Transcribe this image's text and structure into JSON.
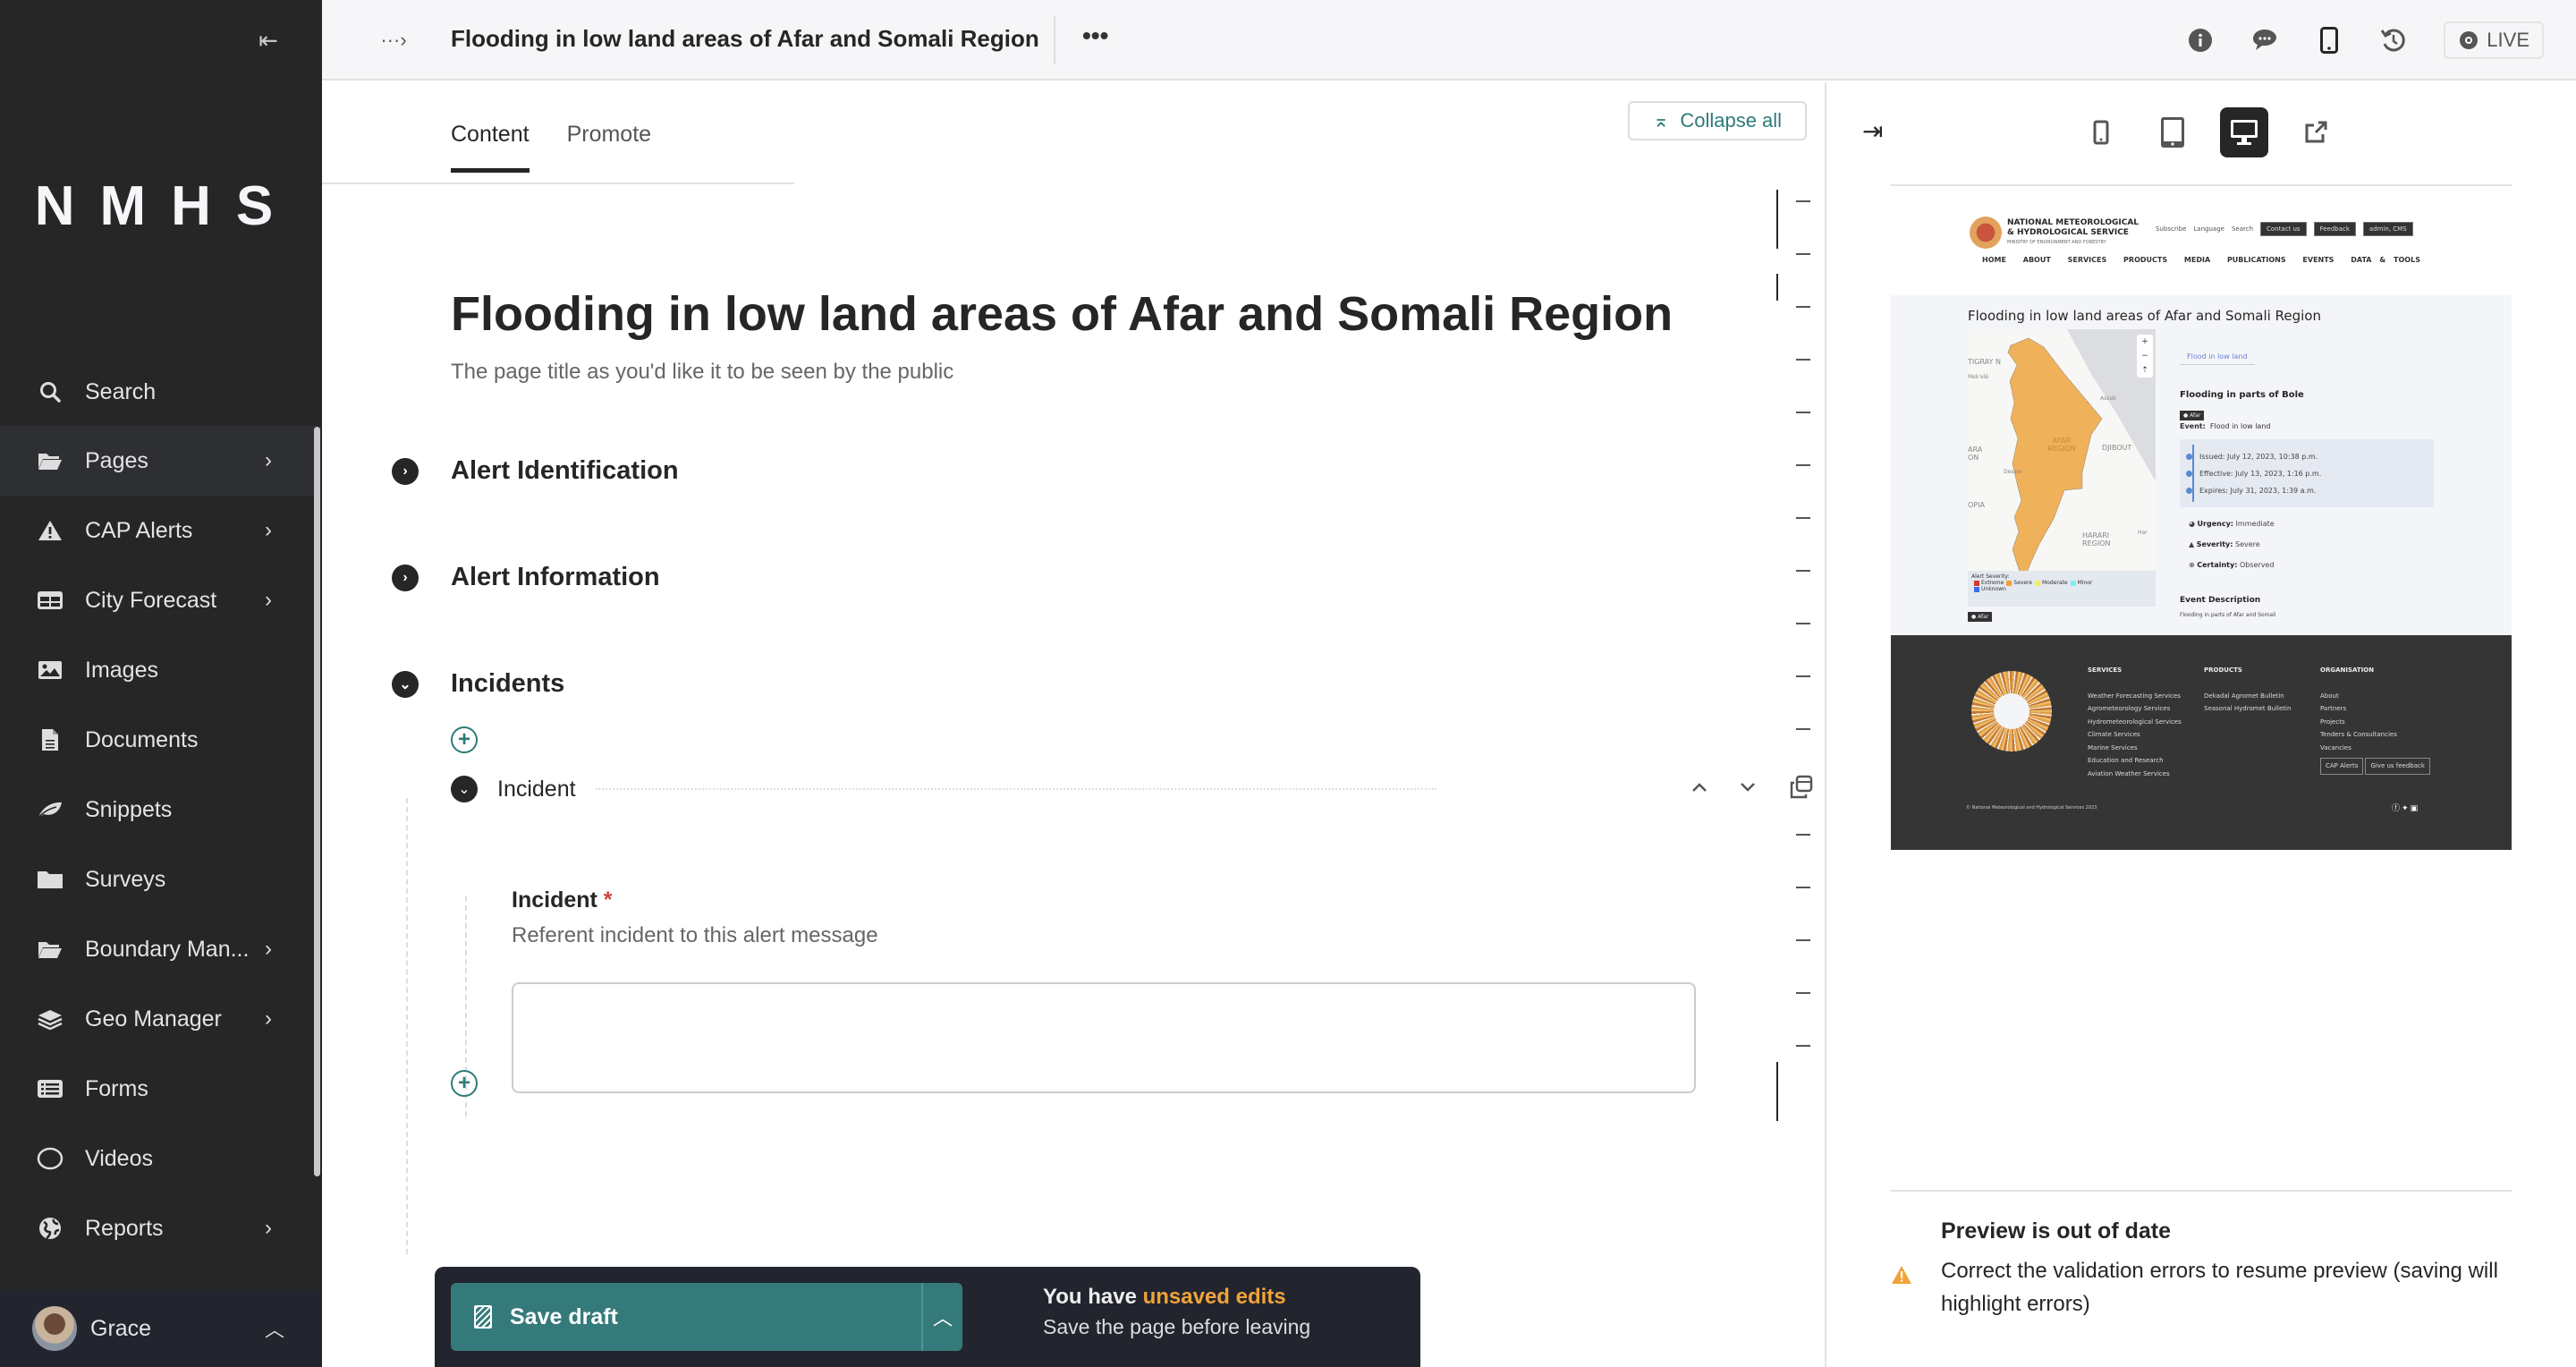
{
  "sidebar": {
    "logo": "NMHS",
    "search_label": "Search",
    "items": [
      {
        "label": "Pages",
        "icon": "folder-open-icon",
        "has_submenu": true,
        "active": true
      },
      {
        "label": "CAP Alerts",
        "icon": "warning-icon",
        "has_submenu": true
      },
      {
        "label": "City Forecast",
        "icon": "table-icon",
        "has_submenu": true
      },
      {
        "label": "Images",
        "icon": "image-icon",
        "has_submenu": false
      },
      {
        "label": "Documents",
        "icon": "document-icon",
        "has_submenu": false
      },
      {
        "label": "Snippets",
        "icon": "leaf-icon",
        "has_submenu": false
      },
      {
        "label": "Surveys",
        "icon": "folder-icon",
        "has_submenu": false
      },
      {
        "label": "Boundary Man...",
        "icon": "folder-open-icon",
        "has_submenu": true
      },
      {
        "label": "Geo Manager",
        "icon": "layers-icon",
        "has_submenu": true
      },
      {
        "label": "Forms",
        "icon": "list-icon",
        "has_submenu": false
      },
      {
        "label": "Videos",
        "icon": "circle-icon",
        "has_submenu": false
      },
      {
        "label": "Reports",
        "icon": "globe-icon",
        "has_submenu": true
      }
    ],
    "user": {
      "name": "Grace"
    }
  },
  "header": {
    "title": "Flooding in low land areas of Afar and Somali Region",
    "live_label": "LIVE"
  },
  "editor": {
    "tabs": [
      {
        "label": "Content",
        "active": true
      },
      {
        "label": "Promote",
        "active": false
      }
    ],
    "collapse_all_label": "Collapse all",
    "page_title_value": "Flooding in low land areas of Afar and Somali Region",
    "page_title_help": "The page title as you'd like it to be seen by the public",
    "sections": [
      {
        "label": "Alert Identification",
        "expanded": false
      },
      {
        "label": "Alert Information",
        "expanded": false
      },
      {
        "label": "Incidents",
        "expanded": true
      }
    ],
    "incident_block": {
      "label": "Incident",
      "field_label": "Incident",
      "required_marker": "*",
      "field_help": "Referent incident to this alert message",
      "field_value": ""
    }
  },
  "footer_bar": {
    "save_label": "Save draft",
    "unsaved_prefix": "You have ",
    "unsaved_highlight": "unsaved edits",
    "unsaved_sub": "Save the page before leaving"
  },
  "preview": {
    "sizes": [
      {
        "name": "mobile",
        "active": false
      },
      {
        "name": "tablet",
        "active": false
      },
      {
        "name": "desktop",
        "active": true
      }
    ],
    "site": {
      "org_line1": "NATIONAL METEOROLOGICAL",
      "org_line2": "& HYDROLOGICAL SERVICE",
      "org_sub": "MINISTRY OF ENVIRONMENT AND FORESTRY",
      "util_links": [
        "Subscribe",
        "Language",
        "Search"
      ],
      "util_buttons": [
        "Contact us",
        "Feedback",
        "admin, CMS"
      ],
      "nav": [
        "HOME",
        "ABOUT",
        "SERVICES",
        "PRODUCTS",
        "MEDIA",
        "PUBLICATIONS",
        "EVENTS",
        "DATA & TOOLS"
      ],
      "title": "Flooding in low land areas of Afar and Somali Region",
      "map_labels": [
        "TIGRAY N",
        "Mek'elē",
        "Assab",
        "AFAR REGION",
        "DJIBOUT",
        "ARA ON",
        "Dessie",
        "OPIA",
        "HARARI REGION",
        "Har"
      ],
      "legend_title": "Alert Severity:",
      "legend": [
        {
          "label": "Extreme",
          "color": "#d03a2f"
        },
        {
          "label": "Severe",
          "color": "#f0a03c"
        },
        {
          "label": "Moderate",
          "color": "#f5f04a"
        },
        {
          "label": "Minor",
          "color": "#7af0f5"
        },
        {
          "label": "Unknown",
          "color": "#3a6ef0"
        }
      ],
      "area_tag": "Afar",
      "event_tab": "Flood in low land",
      "headline": "Flooding in parts of Bole",
      "event_label": "Event:",
      "event_value": "Flood in low land",
      "times": [
        "Issued: July 12, 2023, 10:38 p.m.",
        "Effective: July 13, 2023, 1:16 p.m.",
        "Expires: July 31, 2023, 1:39 a.m."
      ],
      "attributes": [
        {
          "label": "Urgency:",
          "value": "Immediate"
        },
        {
          "label": "Severity:",
          "value": "Severe"
        },
        {
          "label": "Certainty:",
          "value": "Observed"
        }
      ],
      "description_heading": "Event Description",
      "description": "Flooding in parts of Afar and Somali",
      "footer": {
        "services_heading": "SERVICES",
        "services": [
          "Weather Forecasting Services",
          "Agrometeorology Services",
          "Hydrometeorological Services",
          "Climate Services",
          "Marine Services",
          "Education and Research",
          "Aviation Weather Services"
        ],
        "products_heading": "PRODUCTS",
        "products": [
          "Dekadal Agromet Bulletin",
          "Seasonal Hydromet Bulletin"
        ],
        "org_heading": "ORGANISATION",
        "org": [
          "About",
          "Partners",
          "Projects",
          "Tenders & Consultancies",
          "Vacancies"
        ],
        "buttons": [
          "CAP Alerts",
          "Give us feedback"
        ],
        "copyright": "© National Meteorological and Hydrological Services 2023"
      }
    },
    "warning_title": "Preview is out of date",
    "warning_text": "Correct the validation errors to resume preview (saving will highlight errors)",
    "warning_color": "#f0a33a"
  }
}
